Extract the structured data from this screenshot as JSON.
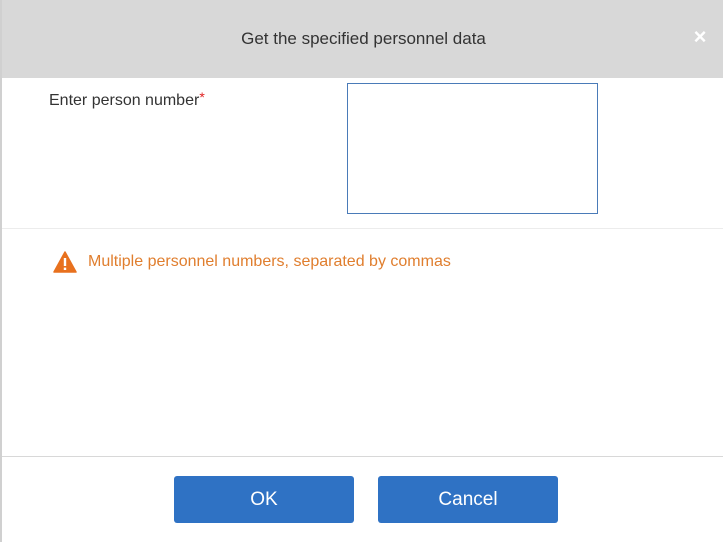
{
  "dialog": {
    "title": "Get the specified personnel data",
    "close_icon": "close-icon",
    "close_glyph": "×"
  },
  "form": {
    "person_number_label": "Enter person number",
    "required_marker": "*",
    "person_number_value": ""
  },
  "hint": {
    "icon": "warning-icon",
    "text": "Multiple personnel numbers, separated by commas"
  },
  "buttons": {
    "ok_label": "OK",
    "cancel_label": "Cancel"
  },
  "colors": {
    "titlebar_bg": "#d8d8d8",
    "button_bg": "#2f72c4",
    "warning_text": "#e07e2e",
    "warning_icon": "#e8711e",
    "required": "#e02020",
    "input_border": "#4a7bb8"
  }
}
